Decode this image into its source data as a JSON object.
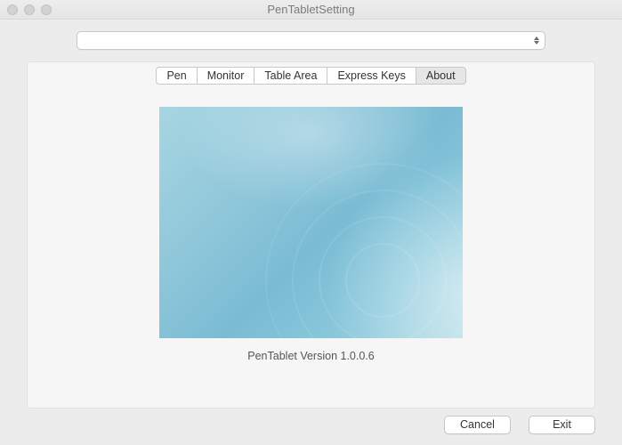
{
  "window": {
    "title": "PenTabletSetting"
  },
  "device_select": {
    "value": ""
  },
  "tabs": [
    {
      "label": "Pen",
      "active": false
    },
    {
      "label": "Monitor",
      "active": false
    },
    {
      "label": "Table Area",
      "active": false
    },
    {
      "label": "Express Keys",
      "active": false
    },
    {
      "label": "About",
      "active": true
    }
  ],
  "about": {
    "version_line": "PenTablet Version  1.0.0.6"
  },
  "footer": {
    "cancel": "Cancel",
    "exit": "Exit"
  }
}
